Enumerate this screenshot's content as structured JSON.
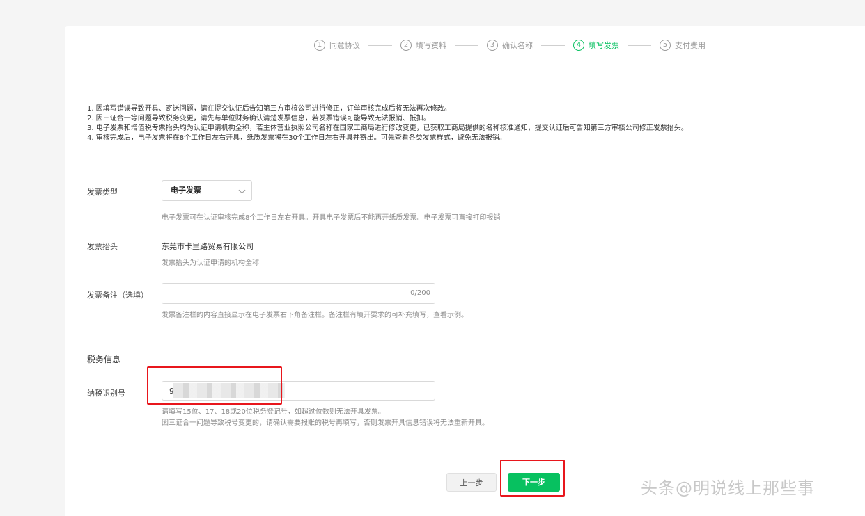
{
  "steps": [
    {
      "num": "1",
      "label": "同意协议",
      "active": false
    },
    {
      "num": "2",
      "label": "填写资料",
      "active": false
    },
    {
      "num": "3",
      "label": "确认名称",
      "active": false
    },
    {
      "num": "4",
      "label": "填写发票",
      "active": true
    },
    {
      "num": "5",
      "label": "支付费用",
      "active": false
    }
  ],
  "notices": [
    "1. 因填写错误导致开具、寄送问题，请在提交认证后告知第三方审核公司进行修正，订单审核完成后将无法再次修改。",
    "2. 因三证合一等问题导致税务变更，请先与单位财务确认清楚发票信息，若发票错误可能导致无法报销、抵扣。",
    "3. 电子发票和增值税专票抬头均为认证申请机构全称，若主体营业执照公司名称在国家工商局进行修改变更，已获取工商局提供的名称核准通知，提交认证后可告知第三方审核公司修正发票抬头。",
    "4. 审核完成后，电子发票将在8个工作日左右开具，纸质发票将在30个工作日左右开具并寄出。可先查看各类发票样式，避免无法报销。"
  ],
  "invoice_type": {
    "label": "发票类型",
    "selected": "电子发票",
    "hint": "电子发票可在认证审核完成8个工作日左右开具。开具电子发票后不能再开纸质发票。电子发票可直接打印报销"
  },
  "invoice_title": {
    "label": "发票抬头",
    "value": "东莞市卡里路贸易有限公司",
    "hint": "发票抬头为认证申请的机构全称"
  },
  "invoice_remark": {
    "label": "发票备注（选填）",
    "counter": "0/200",
    "hint": "发票备注栏的内容直接显示在电子发票右下角备注栏。备注栏有填开要求的可补充填写，查看示例。"
  },
  "tax_section": {
    "title": "税务信息",
    "tax_id_label": "纳税识别号",
    "tax_id_value": "9",
    "hint_1": "请填写15位、17、18或20位税务登记号，如超过位数则无法开具发票。",
    "hint_2": "因三证合一问题导致税号变更的，请确认需要报账的税号再填写，否则发票开具信息错误将无法重新开具。"
  },
  "buttons": {
    "prev": "上一步",
    "next": "下一步"
  },
  "watermark": "头条@明说线上那些事",
  "colors": {
    "accent": "#07c160",
    "highlight": "#e8161c"
  }
}
